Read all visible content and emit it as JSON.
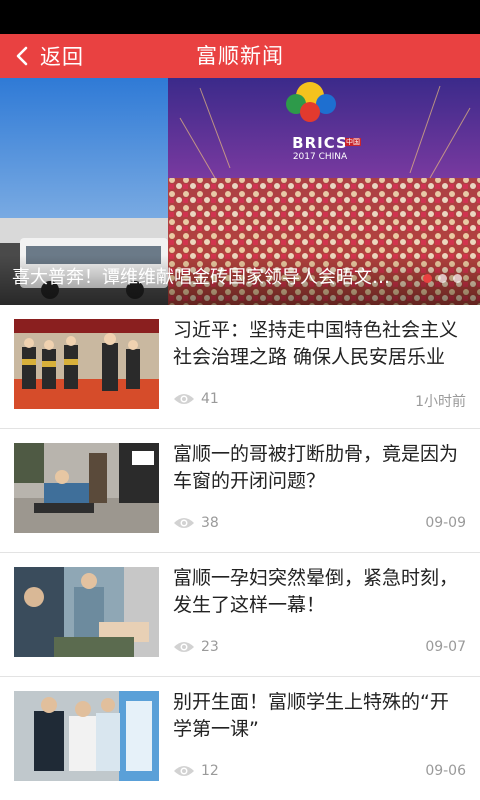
{
  "header": {
    "back_label": "返回",
    "title": "富顺新闻"
  },
  "banner": {
    "caption": "喜大普奔！谭维维献唱金砖国家领导人会晤文艺晚会",
    "logo_text": "BRICS",
    "logo_sub": "2017 CHINA",
    "logo_seal": "中国",
    "slide_count": 3,
    "active_slide": 1
  },
  "news": [
    {
      "title": "习近平：坚持走中国特色社会主义社会治理之路 确保人民安居乐业",
      "views": "41",
      "time": "1小时前"
    },
    {
      "title": "富顺一的哥被打断肋骨，竟是因为车窗的开闭问题？",
      "views": "38",
      "time": "09-09"
    },
    {
      "title": "富顺一孕妇突然晕倒，紧急时刻，发生了这样一幕！",
      "views": "23",
      "time": "09-07"
    },
    {
      "title": "别开生面！富顺学生上特殊的“开学第一课”",
      "views": "12",
      "time": "09-06"
    }
  ],
  "colors": {
    "accent": "#e94141",
    "meta": "#9a9a9a"
  },
  "icons": {
    "back": "chevron-left-icon",
    "views": "eye-icon"
  }
}
